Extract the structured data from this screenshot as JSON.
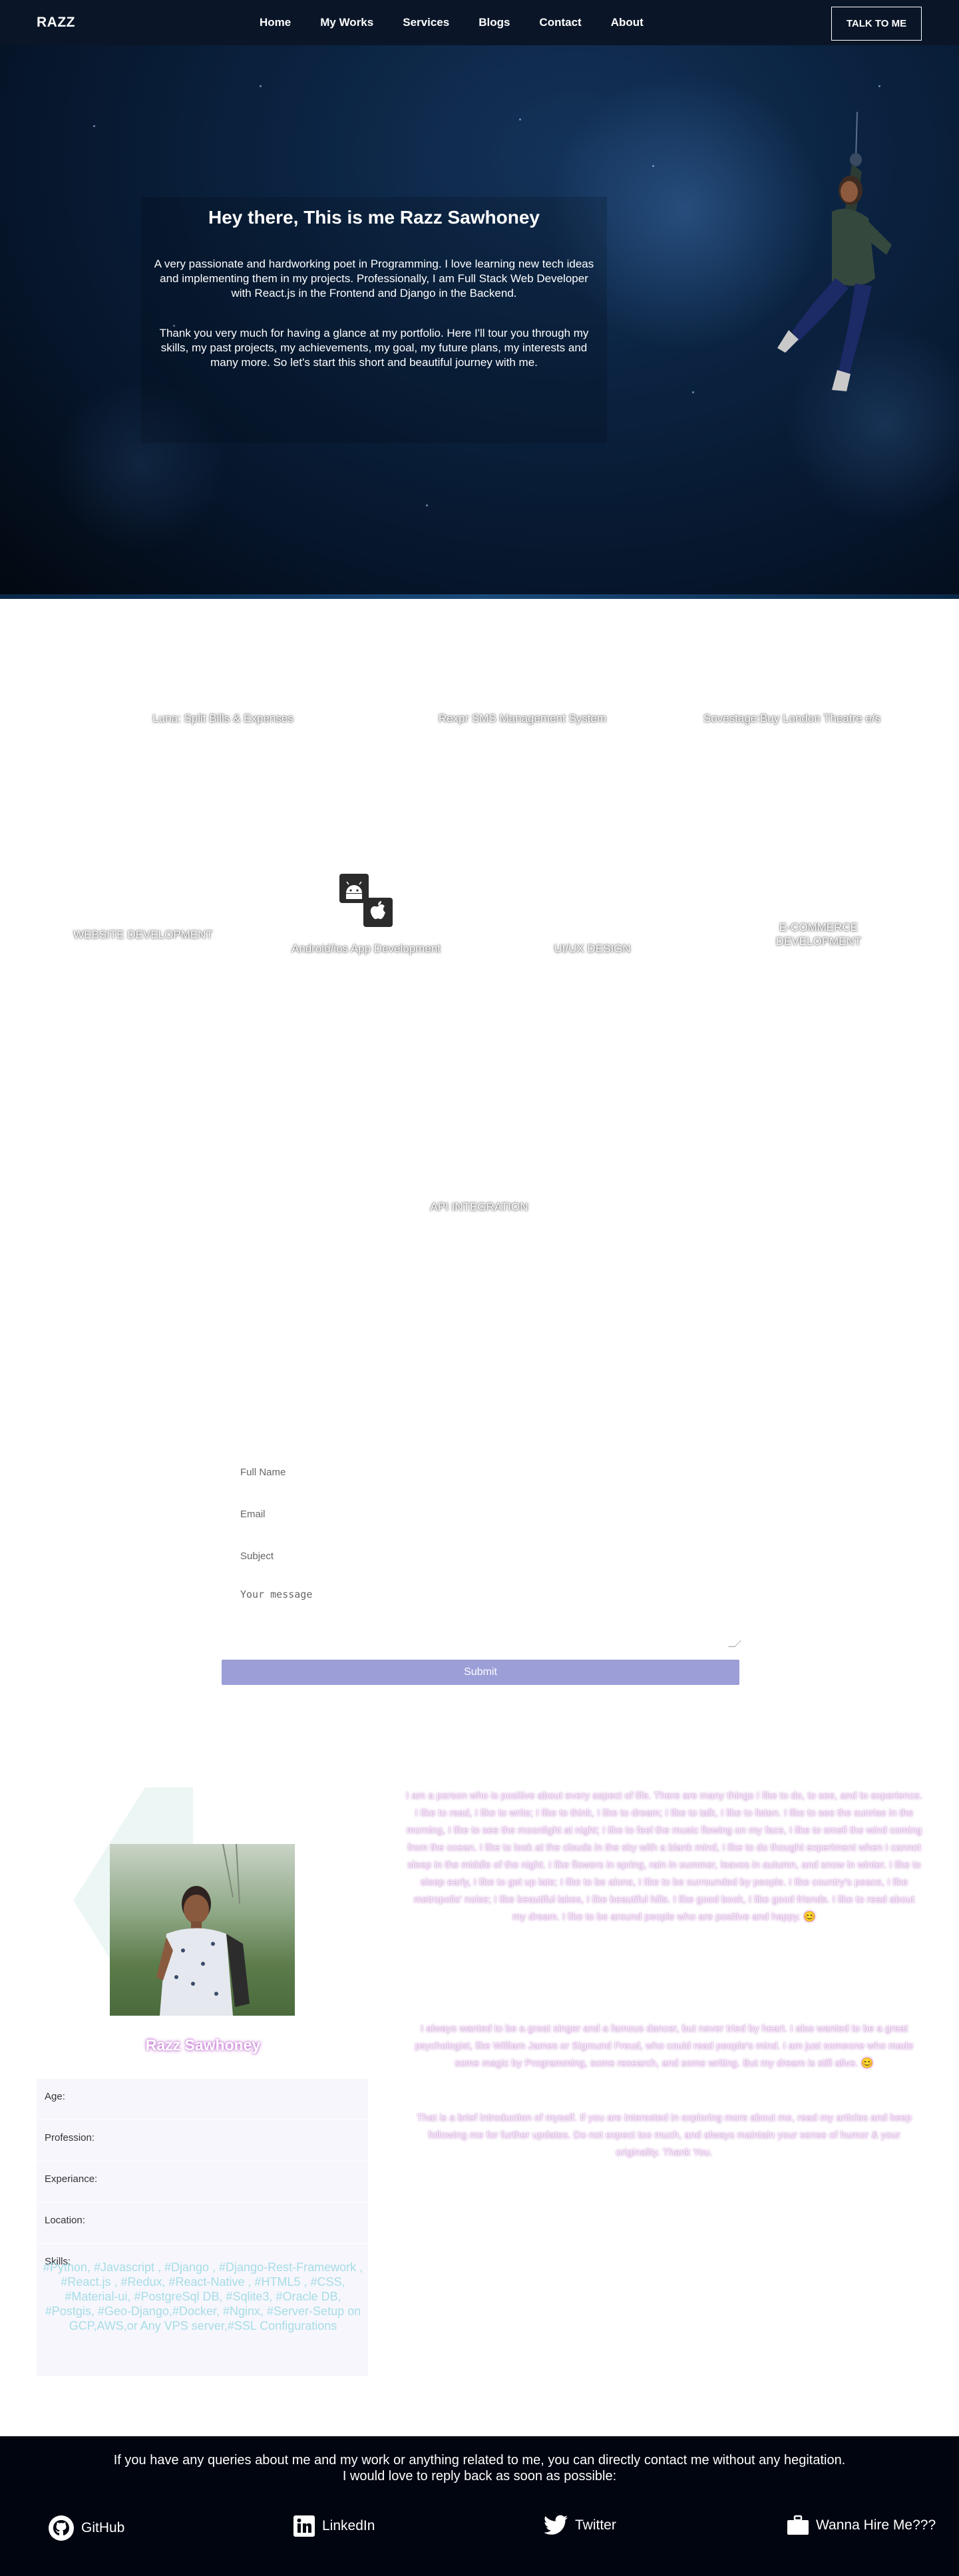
{
  "nav": {
    "brand": "RAZZ",
    "items": [
      "Home",
      "My Works",
      "Services",
      "Blogs",
      "Contact",
      "About"
    ],
    "cta": "TALK TO ME"
  },
  "hero": {
    "title": "Hey there, This is me Razz Sawhoney",
    "p1": "A very passionate and hardworking poet in Programming. I love learning new tech ideas and implementing them in my projects. Professionally, I am Full Stack Web Developer with React.js in the Frontend and Django in the Backend.",
    "p2": "Thank you very much for having a glance at my portfolio. Here I'll tour you through my skills, my past projects, my achievements, my goal, my future plans, my interests and many more. So let's start this short and beautiful journey with me."
  },
  "works": [
    "Luna: Split Bills & Expenses",
    "Rexpr SMS Management System",
    "Sovestage:Buy London Theatre e/s"
  ],
  "services": [
    "WEBSITE DEVELOPMENT",
    "Android/ios App Development",
    "UI/UX DESIGN",
    "E-COMMERCE DEVELOPMENT",
    "API INTEGRATION"
  ],
  "form": {
    "name_ph": "Full Name",
    "email_ph": "Email",
    "subject_ph": "Subject",
    "message_ph": "Your message",
    "submit": "Submit"
  },
  "about": {
    "name": "Razz Sawhoney",
    "rows": [
      {
        "label": "Age:",
        "value": ""
      },
      {
        "label": "Profession:",
        "value": ""
      },
      {
        "label": "Experiance:",
        "value": ""
      },
      {
        "label": "Location:",
        "value": ""
      }
    ],
    "skills_label": "Skills:",
    "skills": "#Python, #Javascript , #Django , #Django-Rest-Framework , #React.js , #Redux, #React-Native , #HTML5 , #CSS, #Material-ui, #PostgreSql DB, #Sqlite3, #Oracle DB, #Postgis, #Geo-Django,#Docker, #Nginx, #Server-Setup on GCP,AWS,or Any VPS server,#SSL Configurations",
    "p1": "I am a person who is positive about every aspect of life. There are many things I like to do, to see, and to experience. I like to read, I like to write; I like to think, I like to dream; I like to talk, I like to listen. I like to see the sunrise in the morning, I like to see the moonlight at night; I like to feel the music flowing on my face, I like to smell the wind coming from the ocean. I like to look at the clouds in the sky with a blank mind, I like to do thought experiment when I cannot sleep in the middle of the night. I like flowers in spring, rain in summer, leaves in autumn, and snow in winter. I like to sleep early, I like to get up late; I like to be alone, I like to be surrounded by people. I like country's peace, I like metropolis' noise; I like beautiful lakes, I like beautiful hills. I like good book, I like good friends. I like to read about my dream. I like to be around people who are positive and happy.",
    "emoji1": "😊",
    "emoji2": "😊",
    "p2": "I always wanted to be a great singer and a famous dancer, but never tried by heart. I also wanted to be a great psychologist, like William James or Sigmund Freud, who could read people's mind. I am just someone who made some magic by Programming, some research, and some writing. But my dream is still alive.",
    "p3": "That is a brief introduction of myself. If you are interested in exploring more about me, read my articles and keep following me for further updates. Do not expect too much, and always maintain your sense of humor & your originality. Thank You."
  },
  "footer": {
    "line1": "If you have any queries about me and my work or anything related to me, you can directly contact me without any hegitation.",
    "line2": "I would love to reply back as soon as possible:",
    "links": [
      "GitHub",
      "LinkedIn",
      "Twitter",
      "Wanna Hire Me???"
    ]
  }
}
